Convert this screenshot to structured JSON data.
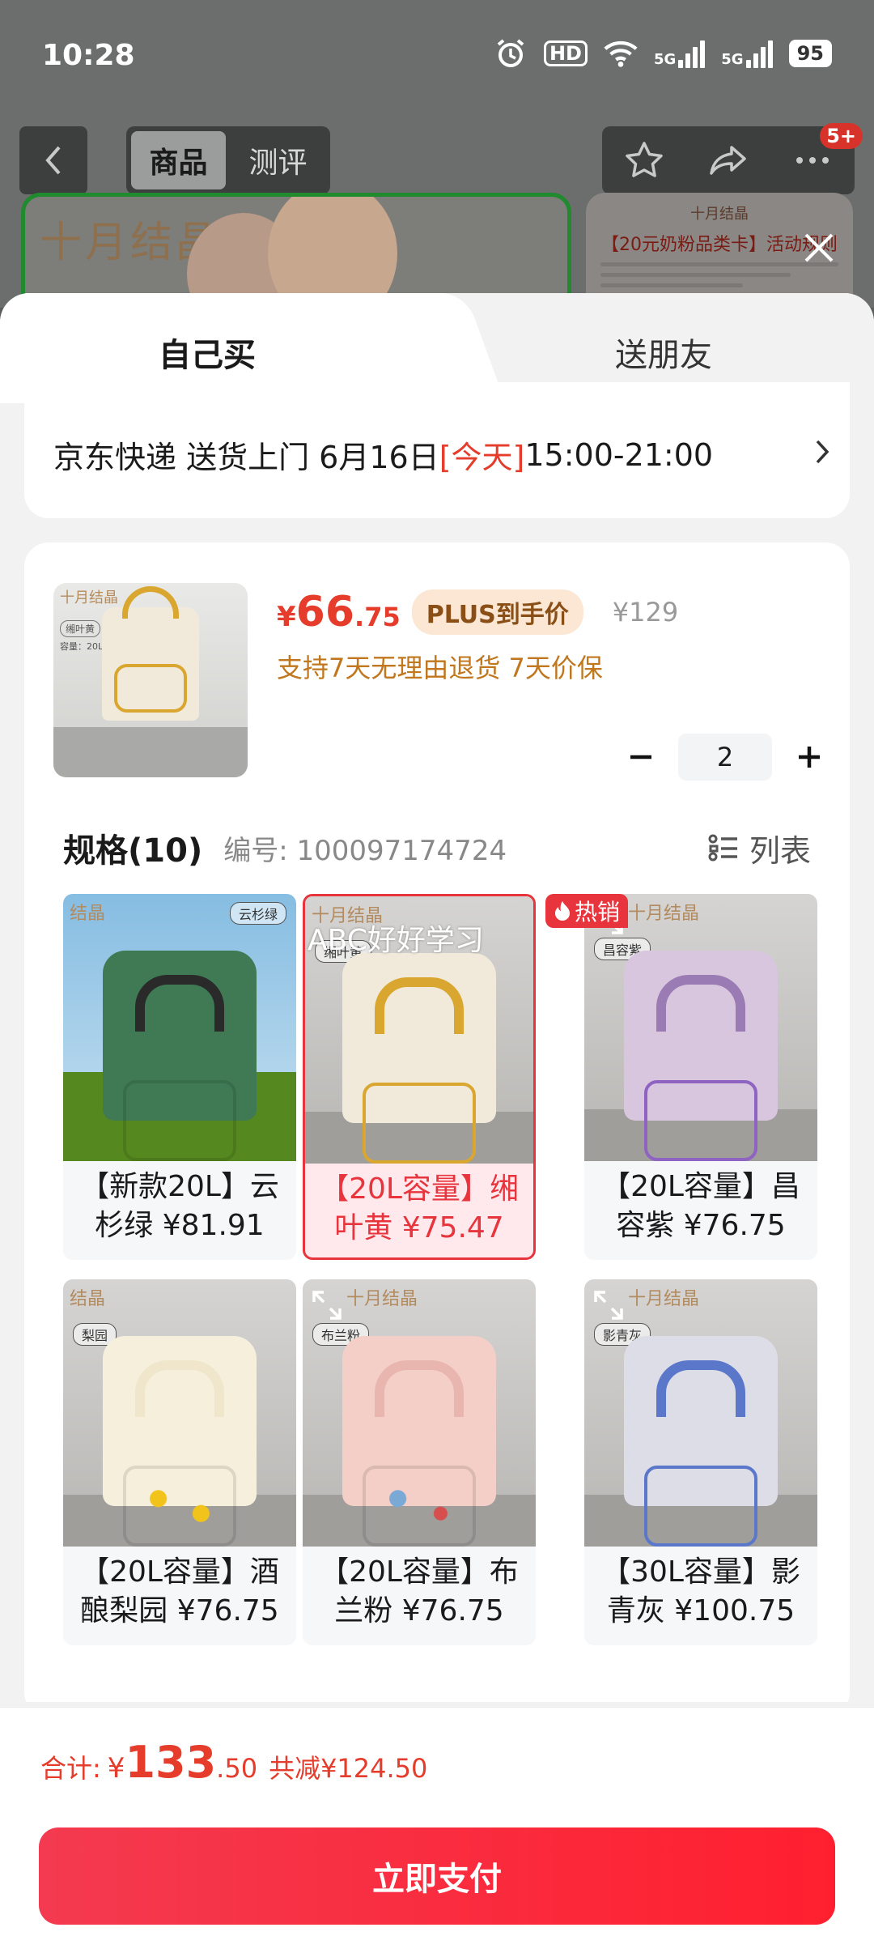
{
  "status_bar": {
    "time": "10:28",
    "hd": "HD",
    "net1": "5G",
    "net2": "5G",
    "battery": "95"
  },
  "nav": {
    "tabs": [
      "商品",
      "测评"
    ],
    "badge": "5+"
  },
  "banner": {
    "brand": "十月结晶",
    "promo_brand": "十月结晶",
    "promo_title": "【20元奶粉品类卡】活动规则"
  },
  "sheet": {
    "tabs": {
      "mine": "自己买",
      "friend": "送朋友"
    },
    "delivery": {
      "carrier": "京东快递 送货上门 6月16日 ",
      "today": "[今天]",
      "time": " 15:00-21:00"
    },
    "product": {
      "thumb_logo": "十月结晶",
      "thumb_tag": "缃叶黄",
      "thumb_cap": "容量：20L",
      "price_currency": "¥",
      "price_int": "66",
      "price_dec": ".75",
      "plus_label": "PLUS到手价",
      "original_price": "¥129",
      "services": "支持7天无理由退货  7天价保",
      "quantity": "2"
    },
    "spec": {
      "title": "规格(10)",
      "sku": "编号: 100097174724",
      "list_label": "列表",
      "hot_label": "热销",
      "watermark": "ABC好好学习",
      "items": [
        {
          "name": "【新款20L】云杉绿 ¥81.91",
          "tag": "云杉绿",
          "logo": "结晶"
        },
        {
          "name": "【20L容量】缃叶黄 ¥75.47",
          "tag": "缃叶黄",
          "logo": "十月结晶"
        },
        {
          "name": "【20L容量】昌容紫 ¥76.75",
          "tag": "昌容紫",
          "logo": "十月结晶"
        },
        {
          "name": "【20L容量】酒酿梨园 ¥76.75",
          "tag": "梨园",
          "logo": "结晶"
        },
        {
          "name": "【20L容量】布兰粉 ¥76.75",
          "tag": "布兰粉",
          "logo": "十月结晶"
        },
        {
          "name": "【30L容量】影青灰 ¥100.75",
          "tag": "影青灰",
          "logo": "十月结晶"
        }
      ]
    }
  },
  "footer": {
    "total_label": "合计:",
    "total_currency": "¥",
    "total_int": "133",
    "total_dec": ".50",
    "saved": "共减¥124.50",
    "pay_label": "立即支付"
  },
  "colors": {
    "accent": "#e53c2b",
    "pay_button": "#ff1f2f",
    "selected_tile_bg": "#ffe9ec",
    "plus_badge_bg": "#fbe7d4"
  }
}
